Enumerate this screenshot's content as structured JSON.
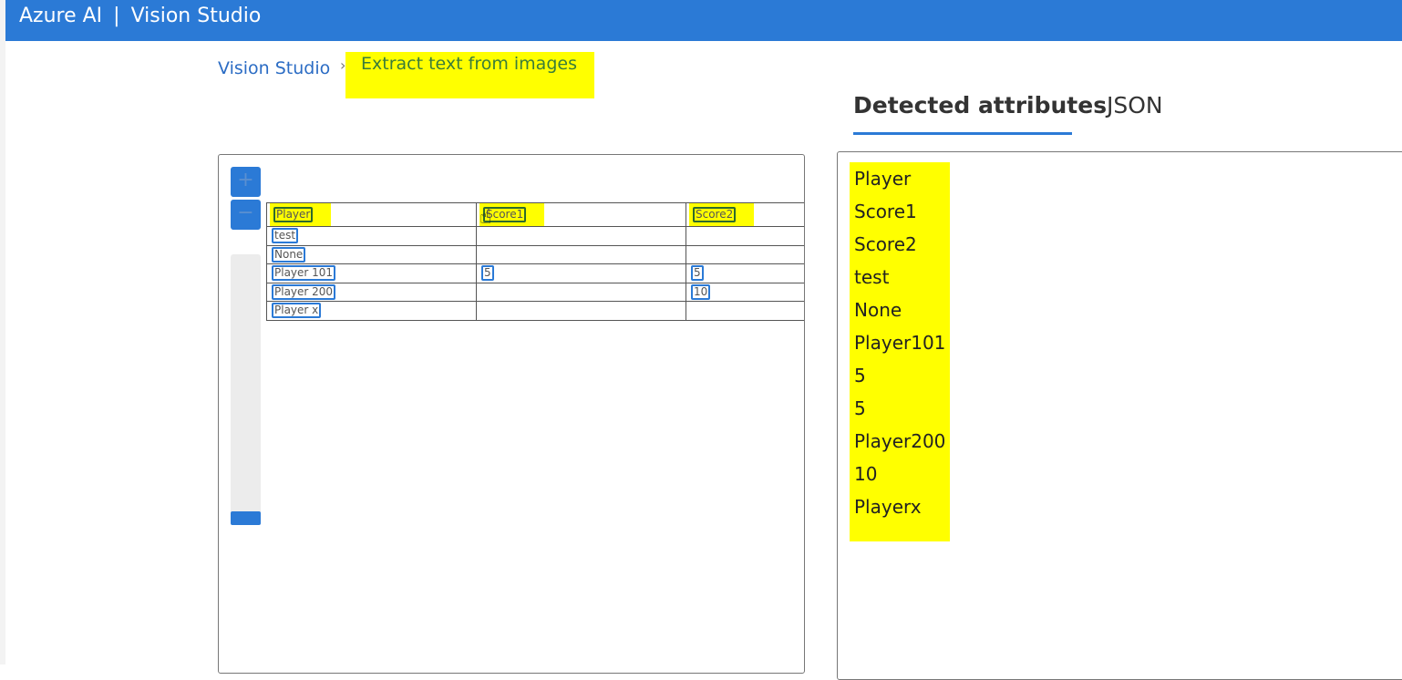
{
  "topbar": {
    "brand": "Azure AI",
    "separator": "|",
    "product": "Vision Studio"
  },
  "breadcrumb": {
    "home": "Vision Studio",
    "current": "Extract text from images"
  },
  "tabs": [
    {
      "label": "Detected attributes",
      "selected": true
    },
    {
      "label": "JSON",
      "selected": false
    }
  ],
  "viewer": {
    "zoom_in_label": "+",
    "zoom_out_label": "−",
    "table": {
      "rows": [
        [
          "Player",
          "Score1",
          "Score2"
        ],
        [
          "test",
          "",
          ""
        ],
        [
          "None",
          "",
          ""
        ],
        [
          "Player 101",
          "5",
          "5"
        ],
        [
          "Player 200",
          "",
          "10"
        ],
        [
          "Player x",
          "",
          ""
        ]
      ]
    }
  },
  "results": {
    "lines": [
      "Player",
      "Score1",
      "Score2",
      "test",
      "None",
      "Player101",
      "5",
      "5",
      "Player200",
      "10",
      "Playerx"
    ]
  },
  "colors": {
    "accent": "#2b7ad6",
    "highlight": "#ffff00"
  }
}
